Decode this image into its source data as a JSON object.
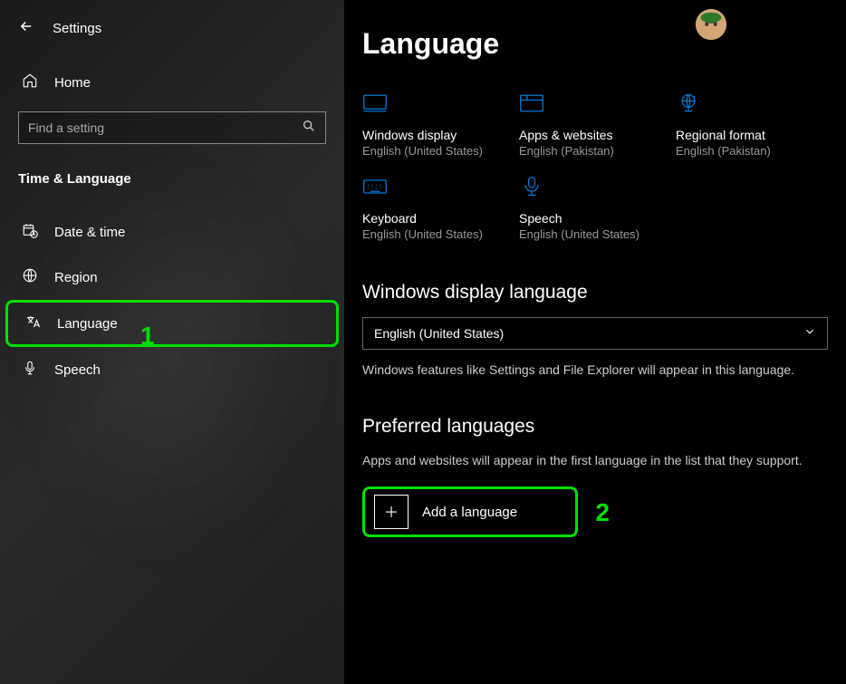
{
  "header": {
    "title": "Settings"
  },
  "sidebar": {
    "home_label": "Home",
    "search_placeholder": "Find a setting",
    "category": "Time & Language",
    "items": [
      {
        "label": "Date & time"
      },
      {
        "label": "Region"
      },
      {
        "label": "Language"
      },
      {
        "label": "Speech"
      }
    ]
  },
  "main": {
    "page_title": "Language",
    "tiles": [
      {
        "title": "Windows display",
        "sub": "English (United States)"
      },
      {
        "title": "Apps & websites",
        "sub": "English (Pakistan)"
      },
      {
        "title": "Regional format",
        "sub": "English (Pakistan)"
      },
      {
        "title": "Keyboard",
        "sub": "English (United States)"
      },
      {
        "title": "Speech",
        "sub": "English (United States)"
      }
    ],
    "display_lang_section": "Windows display language",
    "display_lang_value": "English (United States)",
    "display_lang_help": "Windows features like Settings and File Explorer will appear in this language.",
    "preferred_section": "Preferred languages",
    "preferred_help": "Apps and websites will appear in the first language in the list that they support.",
    "add_language_label": "Add a language"
  },
  "annotations": {
    "one": "1",
    "two": "2"
  }
}
